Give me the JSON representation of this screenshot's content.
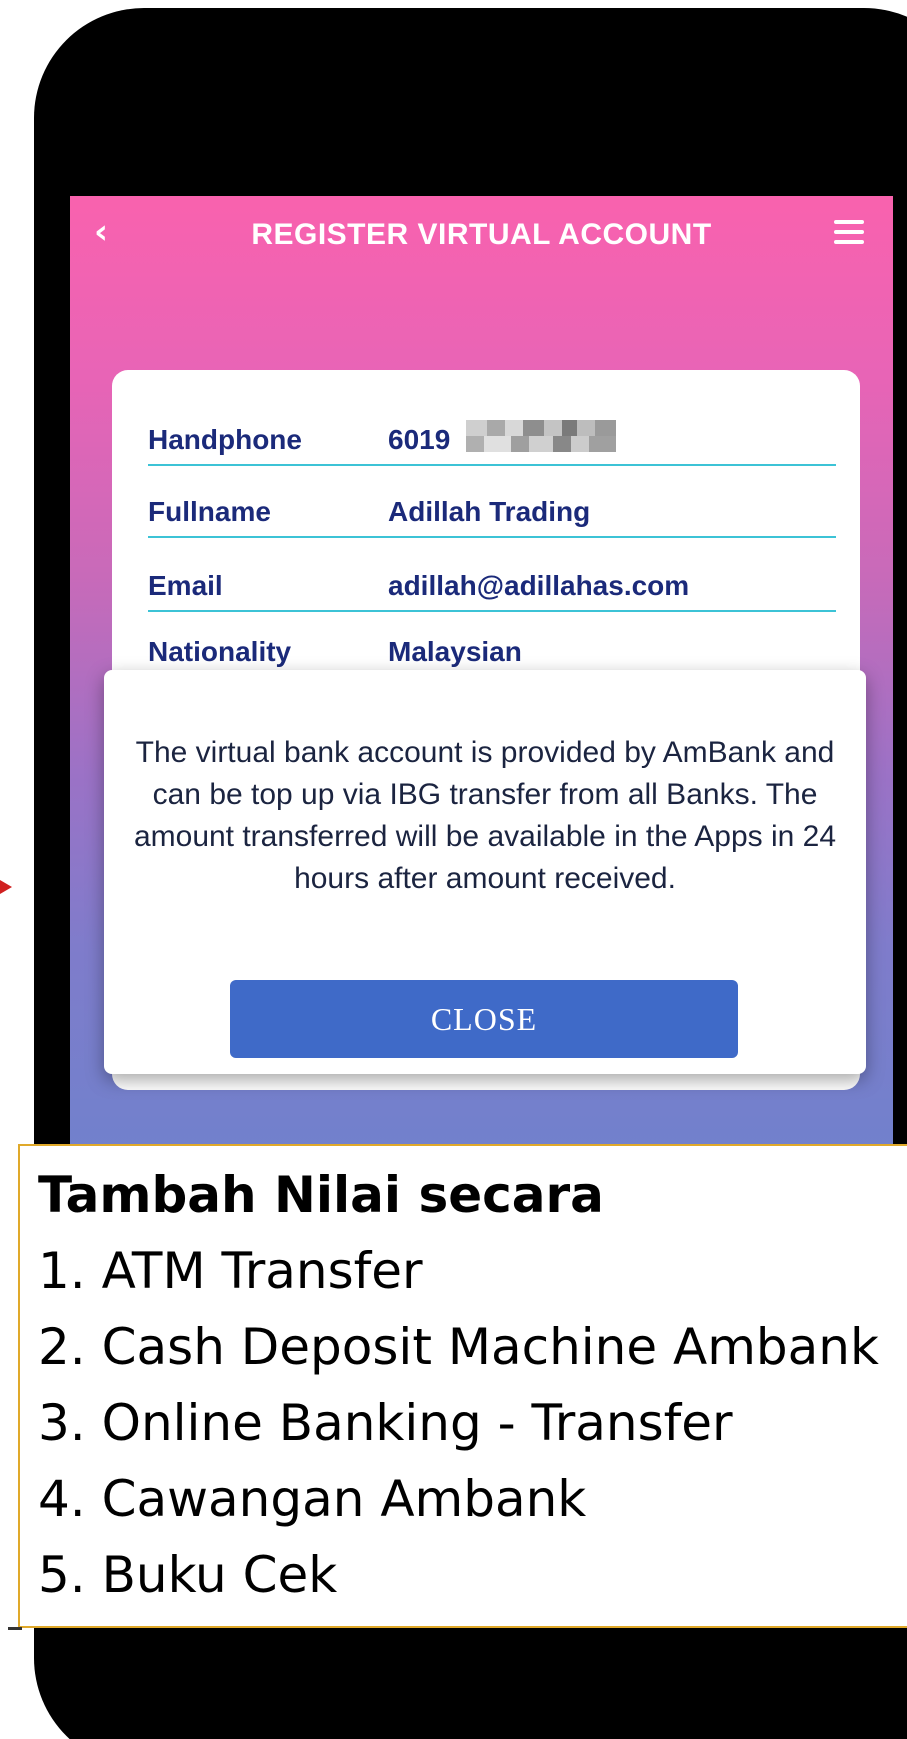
{
  "header": {
    "back_icon": "chevron-left-icon",
    "title": "REGISTER VIRTUAL ACCOUNT",
    "menu_icon": "hamburger-menu-icon"
  },
  "form": {
    "rows": [
      {
        "label": "Handphone",
        "value": "6019"
      },
      {
        "label": "Fullname",
        "value": "Adillah Trading"
      },
      {
        "label": "Email",
        "value": "adillah@adillahas.com"
      },
      {
        "label": "Nationality",
        "value": "Malaysian"
      }
    ]
  },
  "modal": {
    "message": "The virtual bank account is provided by AmBank and can be top up via IBG transfer from all Banks. The amount transferred will be available in the Apps in 24 hours after amount received.",
    "close_label": "CLOSE"
  },
  "note": {
    "title": "Tambah Nilai secara",
    "items": [
      "1. ATM Transfer",
      "2. Cash Deposit Machine Ambank",
      "3. Online Banking - Transfer",
      "4. Cawangan Ambank",
      "5. Buku Cek"
    ]
  },
  "colors": {
    "accent_button": "#3f6ac8",
    "label_text": "#1b2a7a",
    "divider": "#3cc3d6",
    "gradient_top": "#f962ae",
    "gradient_bottom": "#6e82cc",
    "note_border": "#e0a92a"
  }
}
